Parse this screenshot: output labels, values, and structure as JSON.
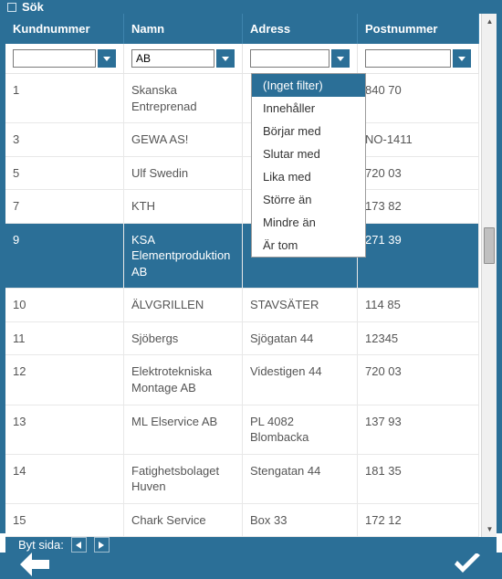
{
  "title": "Sök",
  "columns": [
    "Kundnummer",
    "Namn",
    "Adress",
    "Postnummer"
  ],
  "filters": {
    "kundnummer": "",
    "namn": "AB",
    "adress": "",
    "postnummer": ""
  },
  "filter_menu": {
    "options": [
      "(Inget filter)",
      "Innehåller",
      "Börjar med",
      "Slutar med",
      "Lika med",
      "Större än",
      "Mindre än",
      "Är tom"
    ],
    "selected": 0
  },
  "rows": [
    {
      "id": "1",
      "namn": "Skanska Entreprenad",
      "adress": "",
      "post": "840 70"
    },
    {
      "id": "3",
      "namn": "GEWA AS!",
      "adress": "",
      "post": "NO-1411"
    },
    {
      "id": "5",
      "namn": "Ulf Swedin",
      "adress": "",
      "post": "720 03"
    },
    {
      "id": "7",
      "namn": "KTH",
      "adress": "",
      "post": "173 82"
    },
    {
      "id": "9",
      "namn": "KSA Elementproduktion AB",
      "adress": "",
      "post": "271 39",
      "selected": true
    },
    {
      "id": "10",
      "namn": "ÄLVGRILLEN",
      "adress": "STAVSÄTER",
      "post": "114 85"
    },
    {
      "id": "11",
      "namn": "Sjöbergs",
      "adress": "Sjögatan 44",
      "post": "12345"
    },
    {
      "id": "12",
      "namn": "Elektrotekniska Montage AB",
      "adress": "Videstigen 44",
      "post": "720 03"
    },
    {
      "id": "13",
      "namn": "ML Elservice AB",
      "adress": "PL 4082 Blombacka",
      "post": "137 93"
    },
    {
      "id": "14",
      "namn": "Fatighetsbolaget Huven",
      "adress": "Stengatan 44",
      "post": "181 35"
    },
    {
      "id": "15",
      "namn": "Chark Service",
      "adress": "Box 33",
      "post": "172 12"
    }
  ],
  "pager_label": "Byt sida:",
  "chart_data": null
}
